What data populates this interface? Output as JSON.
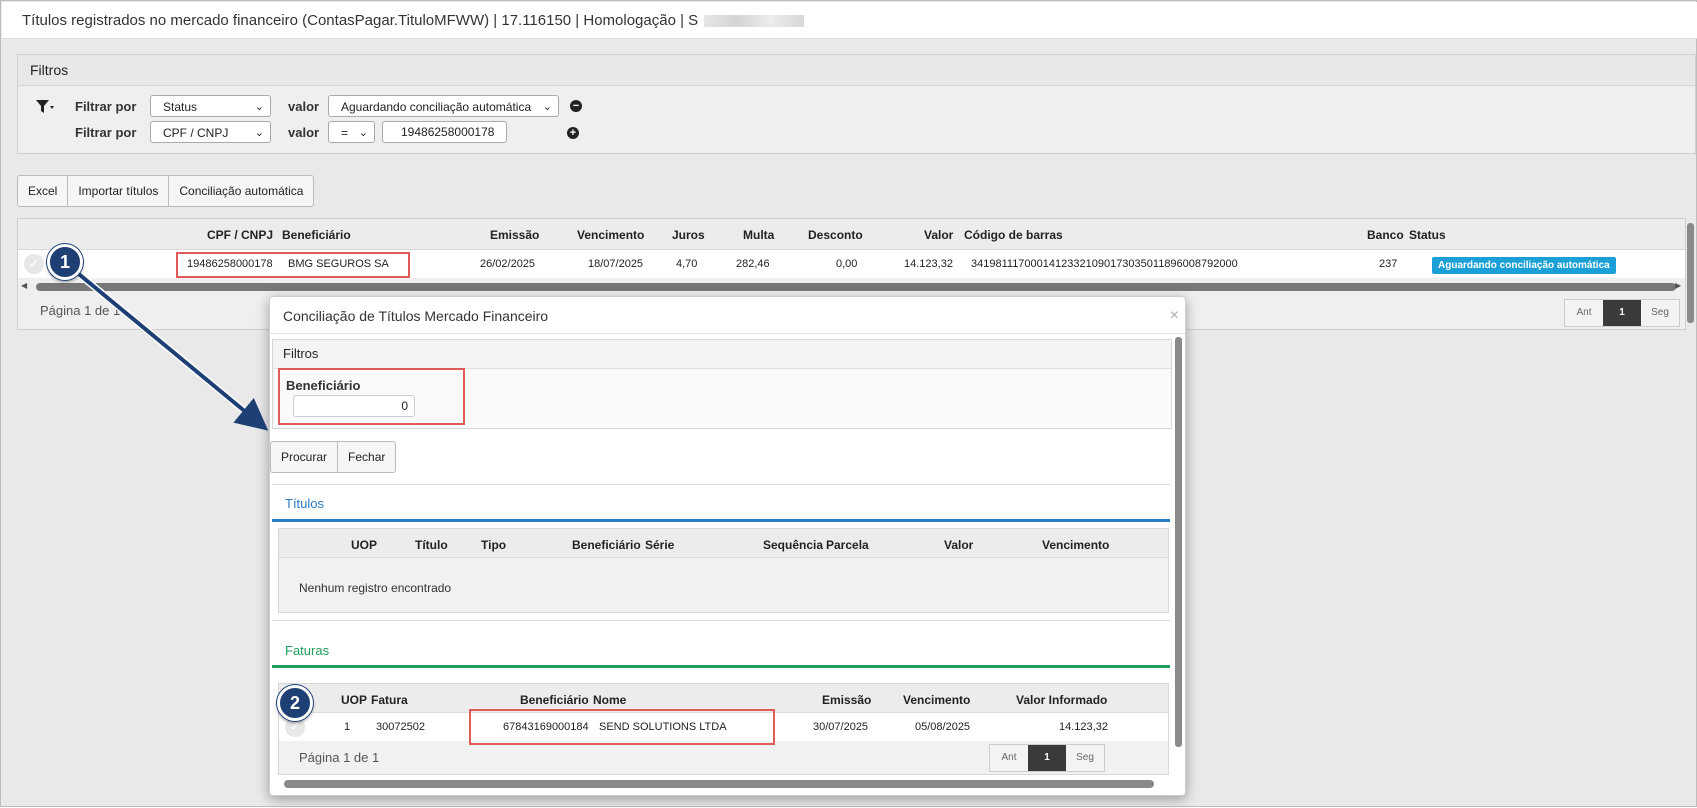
{
  "window": {
    "title": "Títulos registrados no mercado financeiro (ContasPagar.TituloMFWW) | 17.116150 | Homologação | S"
  },
  "filters": {
    "header": "Filtros",
    "row1": {
      "label": "Filtrar por",
      "field": "Status",
      "value_label": "valor",
      "value": "Aguardando conciliação automática"
    },
    "row2": {
      "label": "Filtrar por",
      "field": "CPF / CNPJ",
      "value_label": "valor",
      "operator": "=",
      "value": "19486258000178"
    }
  },
  "toolbar": {
    "excel": "Excel",
    "import": "Importar títulos",
    "reconcile": "Conciliação automática"
  },
  "grid": {
    "columns": [
      "CPF / CNPJ",
      "Beneficiário",
      "Emissão",
      "Vencimento",
      "Juros",
      "Multa",
      "Desconto",
      "Valor",
      "Código de barras",
      "Banco",
      "Status"
    ],
    "row": {
      "cpf": "19486258000178",
      "beneficiario": "BMG SEGUROS SA",
      "emissao": "26/02/2025",
      "vencimento": "18/07/2025",
      "juros": "4,70",
      "multa": "282,46",
      "desconto": "0,00",
      "valor": "14.123,32",
      "codigo": "34198111700014123321090173035011896008792000",
      "banco": "237",
      "status": "Aguardando conciliação automática"
    },
    "page": "Página 1 de 1",
    "pager": {
      "prev": "Ant",
      "current": "1",
      "next": "Seg"
    }
  },
  "modal": {
    "title": "Conciliação de Títulos Mercado Financeiro",
    "close": "×",
    "filters_header": "Filtros",
    "beneficiario_label": "Beneficiário",
    "beneficiario_value": "0",
    "search": "Procurar",
    "close_button": "Fechar",
    "titulos": {
      "title": "Títulos",
      "title_color": "#2a7bbf",
      "columns": [
        "UOP",
        "Título",
        "Tipo",
        "Beneficiário",
        "Série",
        "Sequência",
        "Parcela",
        "Valor",
        "Vencimento"
      ],
      "empty": "Nenhum registro encontrado"
    },
    "faturas": {
      "title": "Faturas",
      "title_color": "#1e9e5a",
      "columns": [
        "UOP",
        "Fatura",
        "Beneficiário",
        "Nome",
        "Emissão",
        "Vencimento",
        "Valor Informado"
      ],
      "row": {
        "uop": "1",
        "fatura": "30072502",
        "beneficiario": "67843169000184",
        "nome": "SEND SOLUTIONS LTDA",
        "emissao": "30/07/2025",
        "vencimento": "05/08/2025",
        "valor": "14.123,32"
      },
      "page": "Página 1 de 1",
      "pager": {
        "prev": "Ant",
        "current": "1",
        "next": "Seg"
      }
    }
  },
  "markers": {
    "one": "1",
    "two": "2"
  }
}
